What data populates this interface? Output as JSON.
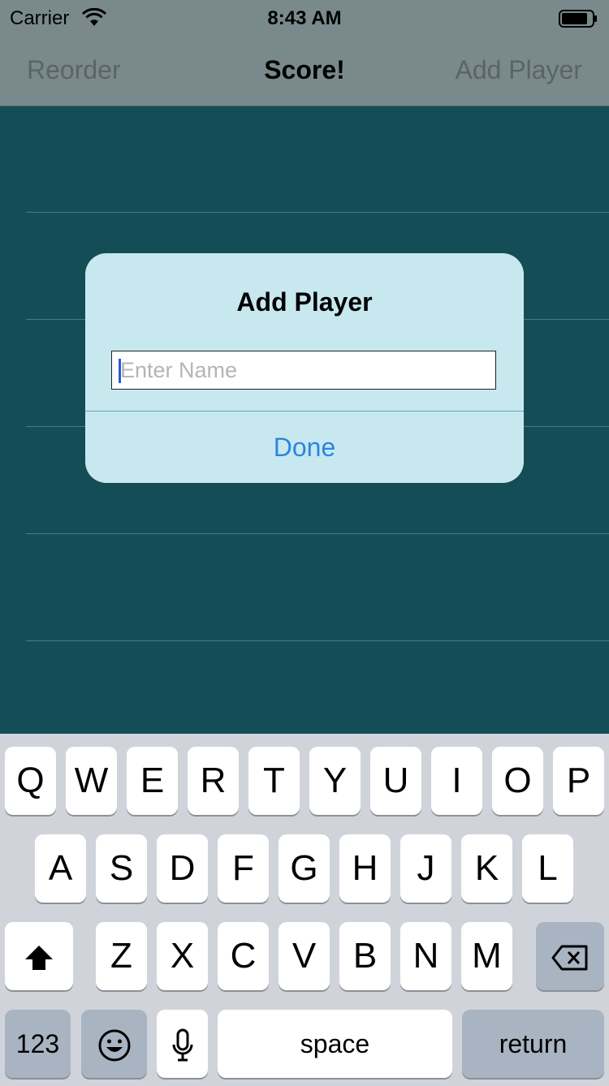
{
  "status_bar": {
    "carrier": "Carrier",
    "time": "8:43 AM"
  },
  "nav_bar": {
    "left_button": "Reorder",
    "title": "Score!",
    "right_button": "Add Player"
  },
  "alert": {
    "title": "Add Player",
    "input_placeholder": "Enter Name",
    "input_value": "",
    "done_label": "Done"
  },
  "keyboard": {
    "row1": [
      "Q",
      "W",
      "E",
      "R",
      "T",
      "Y",
      "U",
      "I",
      "O",
      "P"
    ],
    "row2": [
      "A",
      "S",
      "D",
      "F",
      "G",
      "H",
      "J",
      "K",
      "L"
    ],
    "row3": [
      "Z",
      "X",
      "C",
      "V",
      "B",
      "N",
      "M"
    ],
    "numbers_label": "123",
    "space_label": "space",
    "return_label": "return"
  },
  "colors": {
    "background": "#154d56",
    "bars": "#7a8a8c",
    "alert": "#c8e8f0",
    "accent": "#2b86e0",
    "keyboard": "#d0d4da"
  }
}
